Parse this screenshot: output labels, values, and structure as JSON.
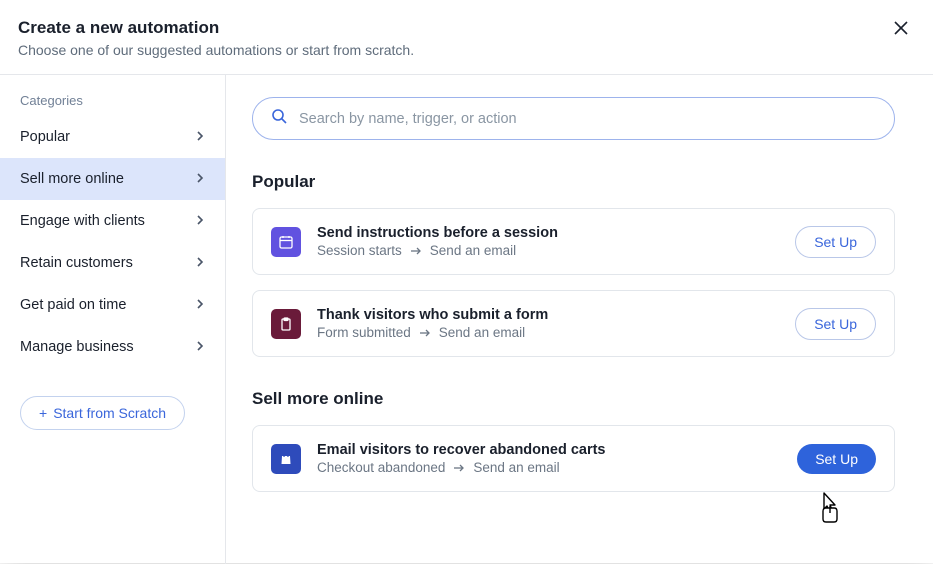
{
  "header": {
    "title": "Create a new automation",
    "subtitle": "Choose one of our suggested automations or start from scratch."
  },
  "sidebar": {
    "categories_label": "Categories",
    "items": [
      {
        "label": "Popular"
      },
      {
        "label": "Sell more online"
      },
      {
        "label": "Engage with clients"
      },
      {
        "label": "Retain customers"
      },
      {
        "label": "Get paid on time"
      },
      {
        "label": "Manage business"
      }
    ],
    "start_scratch": "Start from Scratch"
  },
  "search": {
    "placeholder": "Search by name, trigger, or action"
  },
  "sections": {
    "popular": {
      "title": "Popular",
      "cards": [
        {
          "icon_bg": "#6152e0",
          "icon_name": "calendar-icon",
          "title": "Send instructions before a session",
          "trigger": "Session starts",
          "action": "Send an email",
          "button": "Set Up"
        },
        {
          "icon_bg": "#6a1b3a",
          "icon_name": "clipboard-icon",
          "title": "Thank visitors who submit a form",
          "trigger": "Form submitted",
          "action": "Send an email",
          "button": "Set Up"
        }
      ]
    },
    "sell_more": {
      "title": "Sell more online",
      "cards": [
        {
          "icon_bg": "#2e4bbb",
          "icon_name": "shopping-bag-icon",
          "title": "Email visitors to recover abandoned carts",
          "trigger": "Checkout abandoned",
          "action": "Send an email",
          "button": "Set Up"
        }
      ]
    }
  }
}
